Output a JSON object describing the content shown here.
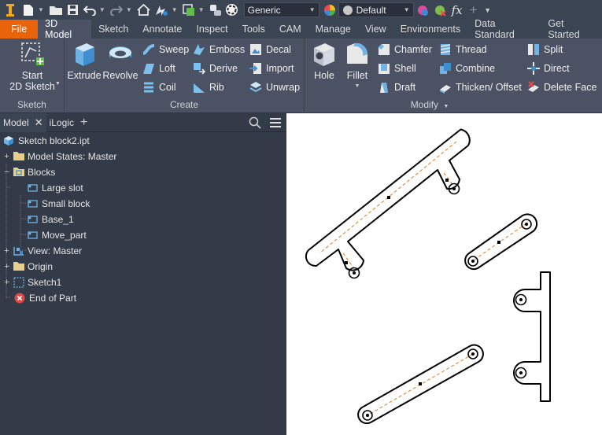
{
  "quick_access": {
    "appearance_style": "Generic",
    "material": "Default",
    "icons": [
      "app-menu-icon",
      "new-icon",
      "open-icon",
      "save-icon",
      "undo-icon",
      "redo-icon",
      "home-icon",
      "update-icon",
      "select-icon",
      "parameters-icon",
      "appearance-icon",
      "color-wheel-icon",
      "material-icon",
      "clear-override-icon",
      "fx-icon",
      "add-icon",
      "customize-icon"
    ]
  },
  "tabs": [
    "File",
    "3D Model",
    "Sketch",
    "Annotate",
    "Inspect",
    "Tools",
    "CAM",
    "Manage",
    "View",
    "Environments",
    "Data Standard",
    "Get Started"
  ],
  "active_tab": "3D Model",
  "ribbon": {
    "sketch_panel": {
      "title": "Sketch",
      "start_sketch_line1": "Start",
      "start_sketch_line2": "2D Sketch"
    },
    "create_panel": {
      "title": "Create",
      "extrude": "Extrude",
      "revolve": "Revolve",
      "sweep": "Sweep",
      "loft": "Loft",
      "coil": "Coil",
      "emboss": "Emboss",
      "derive": "Derive",
      "rib": "Rib",
      "decal": "Decal",
      "import": "Import",
      "unwrap": "Unwrap"
    },
    "modify_panel": {
      "title": "Modify",
      "hole": "Hole",
      "fillet": "Fillet",
      "chamfer": "Chamfer",
      "shell": "Shell",
      "draft": "Draft",
      "thread": "Thread",
      "combine": "Combine",
      "thicken_offset": "Thicken/ Offset",
      "split": "Split",
      "direct": "Direct",
      "delete_face": "Delete Face"
    }
  },
  "browser": {
    "tabs": [
      "Model",
      "iLogic"
    ],
    "tree": {
      "root": "Sketch block2.ipt",
      "model_states": "Model States: Master",
      "blocks": "Blocks",
      "block_items": [
        "Large slot",
        "Small block",
        "Base_1",
        "Move_part"
      ],
      "view": "View: Master",
      "origin": "Origin",
      "sketch": "Sketch1",
      "end_of_part": "End of Part"
    }
  },
  "colors": {
    "accent_file": "#e8630a",
    "ribbon_bg": "#4a5263",
    "browser_bg": "#333b48",
    "sketch_line": "#000000",
    "centerline": "#e07a1f"
  }
}
